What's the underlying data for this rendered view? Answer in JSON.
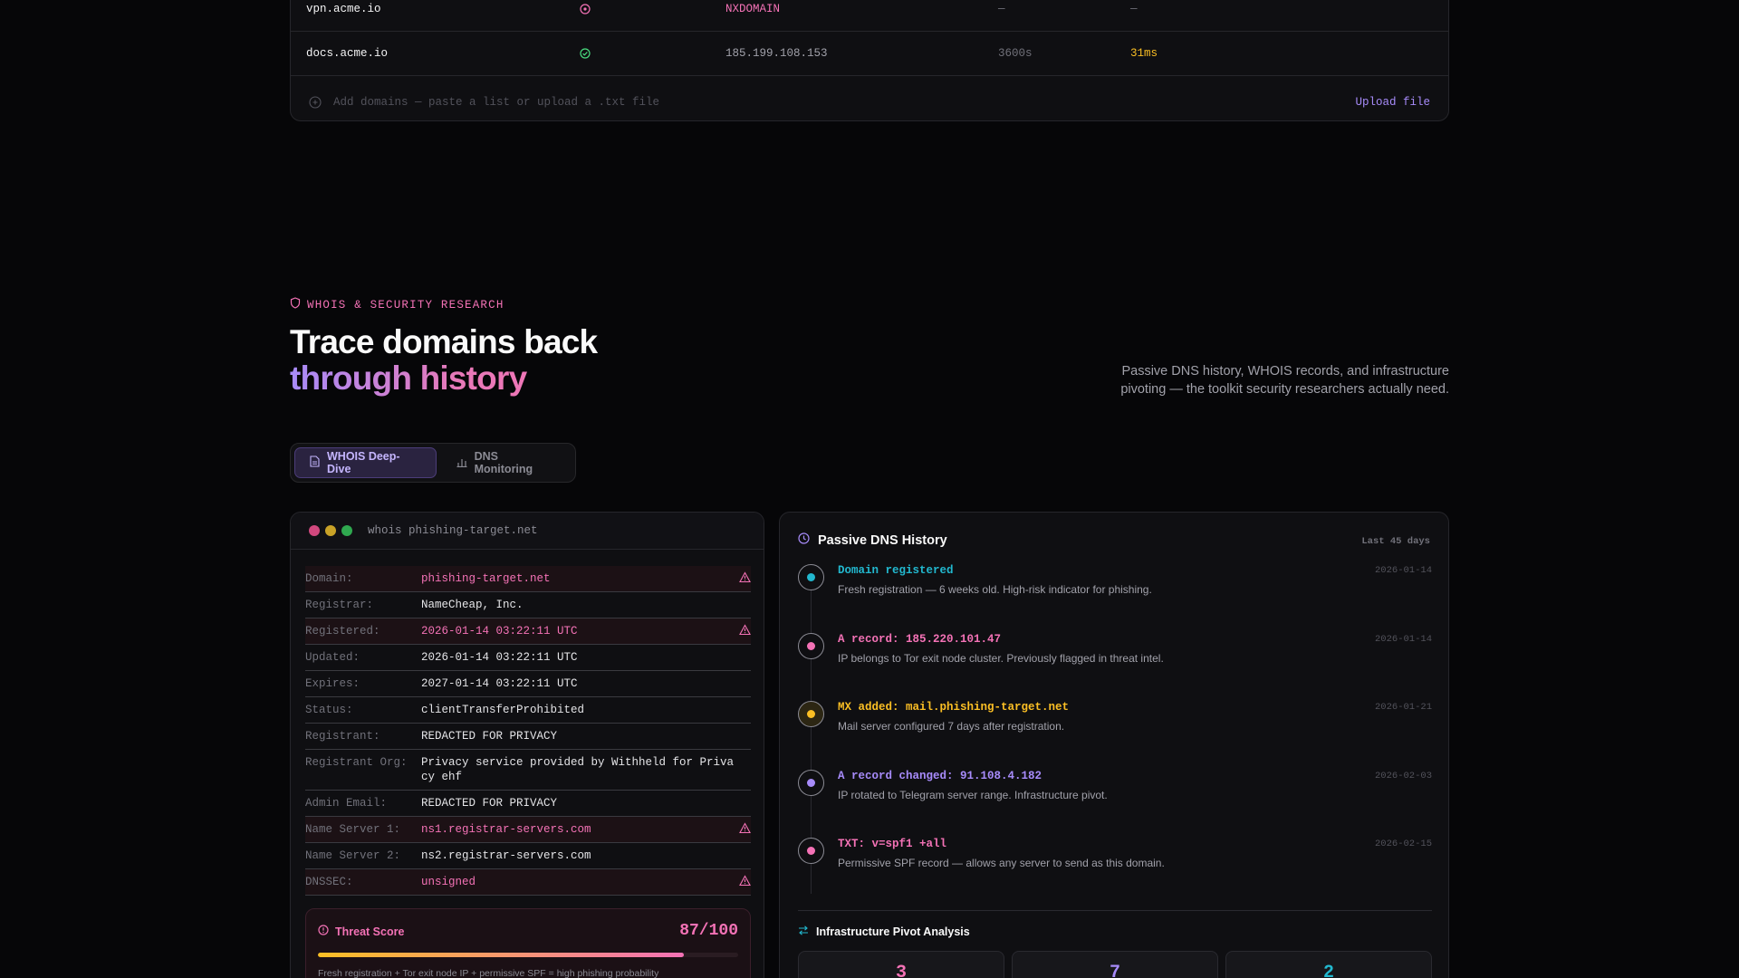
{
  "dns_table": {
    "rows": [
      {
        "host": "vpn.acme.io",
        "status": "error",
        "value": "NXDOMAIN",
        "ttl": "—",
        "latency": "—"
      },
      {
        "host": "docs.acme.io",
        "status": "ok",
        "value": "185.199.108.153",
        "ttl": "3600s",
        "latency": "31ms"
      }
    ],
    "add_placeholder": "Add domains — paste a list or upload a .txt file",
    "upload_label": "Upload file"
  },
  "hero": {
    "eyebrow": "WHOIS & SECURITY RESEARCH",
    "title_line1": "Trace domains back",
    "title_line2": "through history",
    "description": "Passive DNS history, WHOIS records, and infrastructure pivoting — the toolkit security researchers actually need."
  },
  "tabs": [
    {
      "label": "WHOIS Deep-Dive",
      "active": true
    },
    {
      "label": "DNS Monitoring",
      "active": false
    }
  ],
  "whois": {
    "command": "whois phishing-target.net",
    "fields": [
      {
        "key": "Domain:",
        "value": "phishing-target.net",
        "flag": true
      },
      {
        "key": "Registrar:",
        "value": "NameCheap, Inc.",
        "flag": false
      },
      {
        "key": "Registered:",
        "value": "2026-01-14 03:22:11 UTC",
        "flag": true
      },
      {
        "key": "Updated:",
        "value": "2026-01-14 03:22:11 UTC",
        "flag": false
      },
      {
        "key": "Expires:",
        "value": "2027-01-14 03:22:11 UTC",
        "flag": false
      },
      {
        "key": "Status:",
        "value": "clientTransferProhibited",
        "flag": false
      },
      {
        "key": "Registrant:",
        "value": "REDACTED FOR PRIVACY",
        "flag": false
      },
      {
        "key": "Registrant Org:",
        "value": "Privacy service provided by Withheld for Privacy ehf",
        "flag": false
      },
      {
        "key": "Admin Email:",
        "value": "REDACTED FOR PRIVACY",
        "flag": false
      },
      {
        "key": "Name Server 1:",
        "value": "ns1.registrar-servers.com",
        "flag": true
      },
      {
        "key": "Name Server 2:",
        "value": "ns2.registrar-servers.com",
        "flag": false
      },
      {
        "key": "DNSSEC:",
        "value": "unsigned",
        "flag": true
      }
    ],
    "threat": {
      "label": "Threat Score",
      "score_text": "87/100",
      "score": 87,
      "note": "Fresh registration + Tor exit node IP + permissive SPF = high phishing probability"
    }
  },
  "passive_dns": {
    "title": "Passive DNS History",
    "range": "Last 45 days",
    "events": [
      {
        "title": "Domain registered",
        "desc": "Fresh registration — 6 weeks old. High-risk indicator for phishing.",
        "date": "2026-01-14",
        "color": "#22b8cf",
        "node_bg": "#0f0f12"
      },
      {
        "title": "A record: 185.220.101.47",
        "desc": "IP belongs to Tor exit node cluster. Previously flagged in threat intel.",
        "date": "2026-01-14",
        "color": "#f472b6",
        "node_bg": "#0f0f12"
      },
      {
        "title": "MX added: mail.phishing-target.net",
        "desc": "Mail server configured 7 days after registration.",
        "date": "2026-01-21",
        "color": "#fbbf24",
        "node_bg": "#2c2613"
      },
      {
        "title": "A record changed: 91.108.4.182",
        "desc": "IP rotated to Telegram server range. Infrastructure pivot.",
        "date": "2026-02-03",
        "color": "#a78bfa",
        "node_bg": "#0f0f12"
      },
      {
        "title": "TXT: v=spf1 +all",
        "desc": "Permissive SPF record — allows any server to send as this domain.",
        "date": "2026-02-15",
        "color": "#f472b6",
        "node_bg": "#0f0f12"
      }
    ],
    "pivot": {
      "title": "Infrastructure Pivot Analysis",
      "stats": [
        {
          "value": "3",
          "color": "#f472b6"
        },
        {
          "value": "7",
          "color": "#a78bfa"
        },
        {
          "value": "2",
          "color": "#22b8cf"
        }
      ]
    }
  },
  "colors": {
    "accent_pink": "#f472b6",
    "accent_violet": "#a78bfa",
    "accent_cyan": "#22b8cf",
    "accent_amber": "#fbbf24",
    "ok_green": "#4ade80"
  }
}
